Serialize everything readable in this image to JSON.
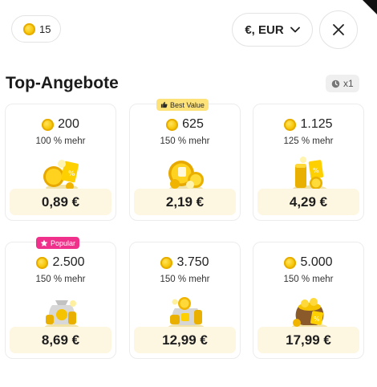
{
  "header": {
    "balance": "15",
    "currency_label": "€, EUR",
    "close_label": "close"
  },
  "section": {
    "title": "Top-Angebote",
    "timer_label": "x1"
  },
  "offers": [
    {
      "amount": "200",
      "bonus": "100 % mehr",
      "price": "0,89 €",
      "badge": ""
    },
    {
      "amount": "625",
      "bonus": "150 % mehr",
      "price": "2,19 €",
      "badge": "Best Value"
    },
    {
      "amount": "1.125",
      "bonus": "125 % mehr",
      "price": "4,29 €",
      "badge": ""
    },
    {
      "amount": "2.500",
      "bonus": "150 % mehr",
      "price": "8,69 €",
      "badge": "Popular"
    },
    {
      "amount": "3.750",
      "bonus": "150 % mehr",
      "price": "12,99 €",
      "badge": ""
    },
    {
      "amount": "5.000",
      "bonus": "150 % mehr",
      "price": "17,99 €",
      "badge": ""
    }
  ],
  "icons": {
    "coin": "coin-icon",
    "chevron": "chevron-down-icon",
    "close": "close-icon",
    "clock": "clock-icon",
    "thumbs_up": "thumbs-up-icon",
    "star": "star-icon"
  },
  "colors": {
    "price_bg": "#fdf6e0",
    "coin": "#f6c300",
    "best_value_badge": "#fde27a",
    "popular_badge": "#f0318b"
  }
}
